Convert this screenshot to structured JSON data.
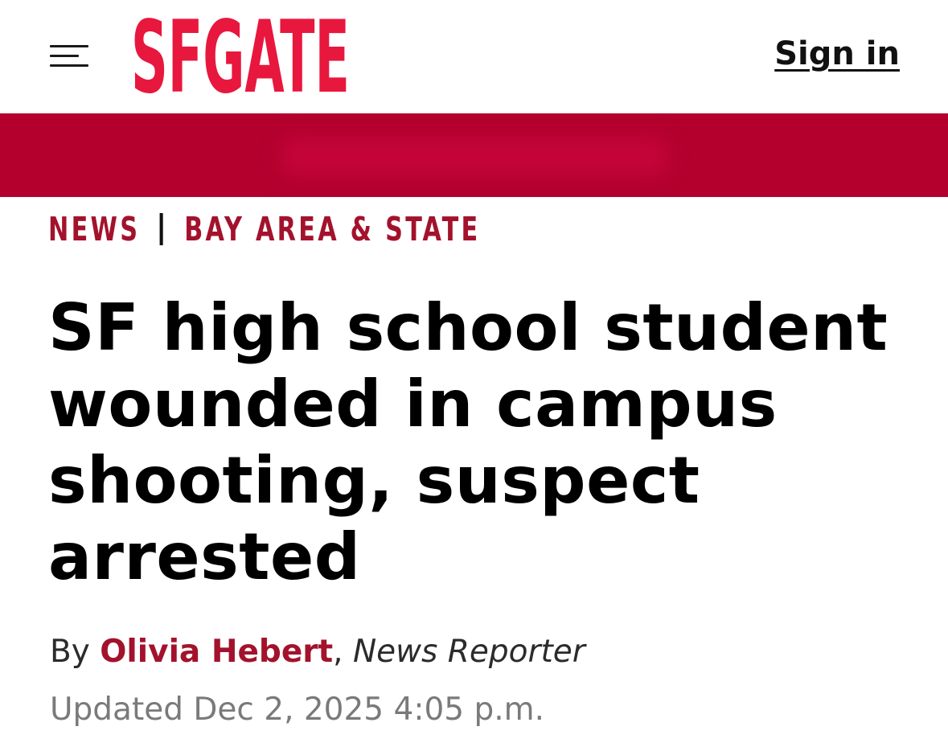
{
  "header": {
    "logo_text": "SFGATE",
    "signin_label": "Sign in",
    "menu_icon": "hamburger-menu-icon"
  },
  "colors": {
    "brand_red": "#e8173d",
    "section_red": "#a3122c",
    "banner": "#b3002d"
  },
  "breadcrumb": {
    "items": [
      "NEWS",
      "BAY AREA & STATE"
    ]
  },
  "article": {
    "headline": "SF high school student wounded in campus shooting, suspect arrested",
    "byline_prefix": "By",
    "author": "Olivia Hebert",
    "author_separator": ",",
    "role": "News Reporter",
    "updated": "Updated Dec 2, 2025 4:05 p.m."
  }
}
